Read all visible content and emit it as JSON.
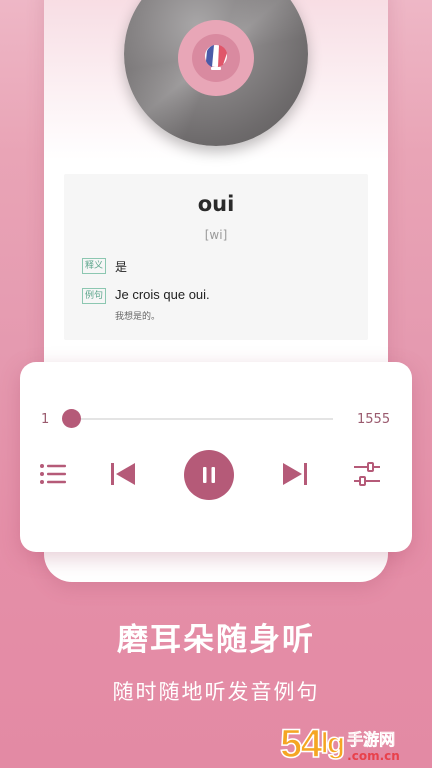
{
  "word_card": {
    "word": "oui",
    "phonetic": "[wi]",
    "meaning_tag": "释义",
    "meaning": "是",
    "example_tag": "例句",
    "example": "Je crois que oui.",
    "example_translation": "我想是的。"
  },
  "player": {
    "position_start": "1",
    "position_end": "1555",
    "progress": 0.0,
    "icons": [
      "playlist-icon",
      "previous-icon",
      "pause-icon",
      "next-icon",
      "equalizer-icon"
    ]
  },
  "caption": {
    "headline": "磨耳朵随身听",
    "subline": "随时随地听发音例句"
  },
  "watermark": {
    "number": "54",
    "extra": "lg",
    "cn": "手游网",
    "domain": ".com.cn"
  },
  "colors": {
    "accent": "#b55a78",
    "background": "#e59ab0",
    "tag_green": "#5aa48a"
  }
}
